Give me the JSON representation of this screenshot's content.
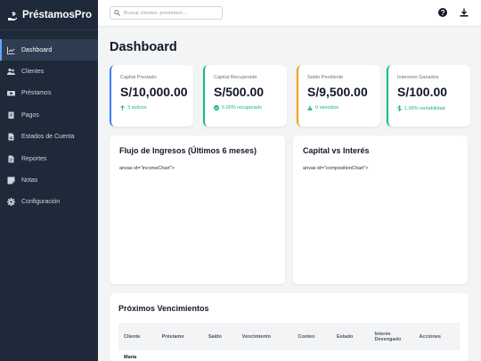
{
  "app": {
    "name": "PréstamosPro"
  },
  "sidebar": {
    "items": [
      {
        "label": "Dashboard",
        "icon": "chart-icon"
      },
      {
        "label": "Clientes",
        "icon": "users-icon"
      },
      {
        "label": "Préstamos",
        "icon": "money-icon"
      },
      {
        "label": "Pagos",
        "icon": "receipt-icon"
      },
      {
        "label": "Estados de Cuenta",
        "icon": "file-invoice-icon"
      },
      {
        "label": "Reportes",
        "icon": "file-alt-icon"
      },
      {
        "label": "Notas",
        "icon": "sticky-note-icon"
      },
      {
        "label": "Configuración",
        "icon": "gear-icon"
      }
    ]
  },
  "search": {
    "placeholder": "Buscar clientes, préstamos..."
  },
  "page": {
    "title": "Dashboard"
  },
  "stats": [
    {
      "label": "Capital Prestado",
      "value": "S/10,000.00",
      "sub": "3 activos",
      "color": "#3b82f6",
      "sub_color": "#10b981"
    },
    {
      "label": "Capital Recuperado",
      "value": "S/500.00",
      "sub": "5.00% recuperado",
      "color": "#10b981",
      "sub_color": "#10b981"
    },
    {
      "label": "Saldo Pendiente",
      "value": "S/9,500.00",
      "sub": "0 vencidos",
      "color": "#f59e0b",
      "sub_color": "#10b981"
    },
    {
      "label": "Intereses Ganados",
      "value": "S/100.00",
      "sub": "1.00% rentabilidad",
      "color": "#10b981",
      "sub_color": "#10b981"
    }
  ],
  "panels": {
    "income": {
      "title": "Flujo de Ingresos (Últimos 6 meses)",
      "text": "anvas id=\"incomeChart\">"
    },
    "composition": {
      "title": "Capital vs Interés",
      "text": "anvas id=\"compositionChart\">"
    }
  },
  "upcoming": {
    "title": "Próximos Vencimientos",
    "columns": [
      "Cliente",
      "Préstamo",
      "Saldo",
      "Vencimiento",
      "Conteo",
      "Estado",
      "Interés Devengado",
      "Acciones"
    ],
    "rows": [
      {
        "cliente": "María"
      }
    ]
  }
}
